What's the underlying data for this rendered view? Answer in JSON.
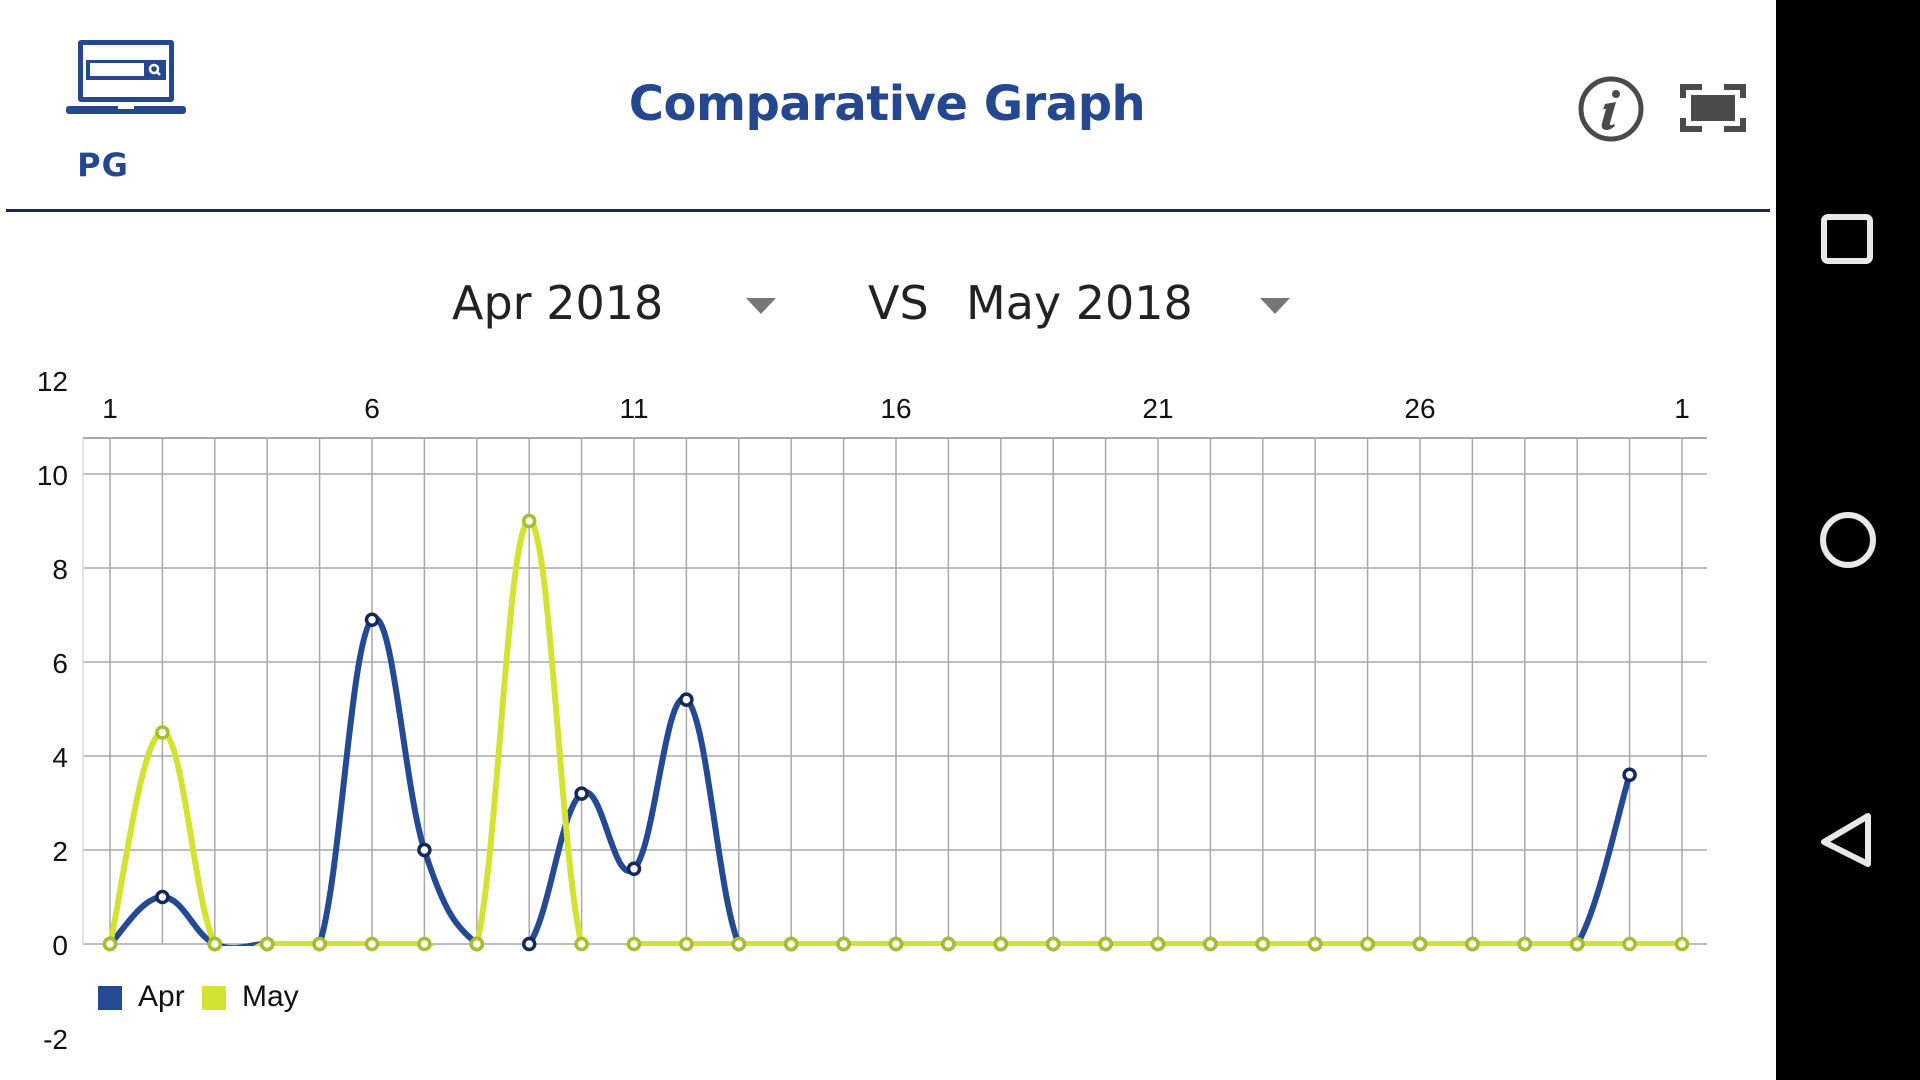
{
  "header": {
    "logo_label": "PG",
    "logo_icon": "laptop-search-icon",
    "title": "Comparative Graph",
    "info_icon": "info-icon",
    "fit_icon": "fit-screen-icon"
  },
  "selectors": {
    "left": {
      "value": "Apr 2018",
      "icon": "dropdown-arrow-icon"
    },
    "vs_label": "VS",
    "right": {
      "value": "May 2018",
      "icon": "dropdown-arrow-icon"
    }
  },
  "colors": {
    "brand": "#24478f",
    "apr": "#244a94",
    "may": "#d4e233",
    "apr_marker": "#14285a",
    "may_marker": "#a9bd2d",
    "grid": "#a9a9a9",
    "divider": "#1b2b55"
  },
  "chart_data": {
    "type": "line",
    "title": "",
    "xlabel": "",
    "ylabel": "",
    "x": [
      1,
      2,
      3,
      4,
      5,
      6,
      7,
      8,
      9,
      10,
      11,
      12,
      13,
      14,
      15,
      16,
      17,
      18,
      19,
      20,
      21,
      22,
      23,
      24,
      25,
      26,
      27,
      28,
      29,
      30,
      31
    ],
    "x_tick_labels": [
      "1",
      "6",
      "11",
      "16",
      "21",
      "26",
      "1"
    ],
    "x_tick_positions": [
      1,
      6,
      11,
      16,
      21,
      26,
      31
    ],
    "x_axis_position": "top",
    "y_ticks": [
      12,
      10,
      8,
      6,
      4,
      2,
      0,
      -2
    ],
    "ylim": [
      -2,
      12
    ],
    "grid": true,
    "smooth": true,
    "legend_position": "bottom-left",
    "series": [
      {
        "name": "Apr",
        "values": [
          0,
          1,
          0,
          0,
          0,
          6.9,
          2,
          0,
          0,
          3.2,
          1.6,
          5.2,
          0,
          0,
          0,
          0,
          0,
          0,
          0,
          0,
          0,
          0,
          0,
          0,
          0,
          0,
          0,
          0,
          0,
          3.6
        ]
      },
      {
        "name": "May",
        "values": [
          0,
          4.5,
          0,
          0,
          0,
          0,
          0,
          0,
          9,
          0,
          0,
          0,
          0,
          0,
          0,
          0,
          0,
          0,
          0,
          0,
          0,
          0,
          0,
          0,
          0,
          0,
          0,
          0,
          0,
          0,
          0
        ]
      }
    ]
  },
  "navbar": {
    "recents_icon": "recents-square-icon",
    "home_icon": "home-circle-icon",
    "back_icon": "back-triangle-icon"
  }
}
